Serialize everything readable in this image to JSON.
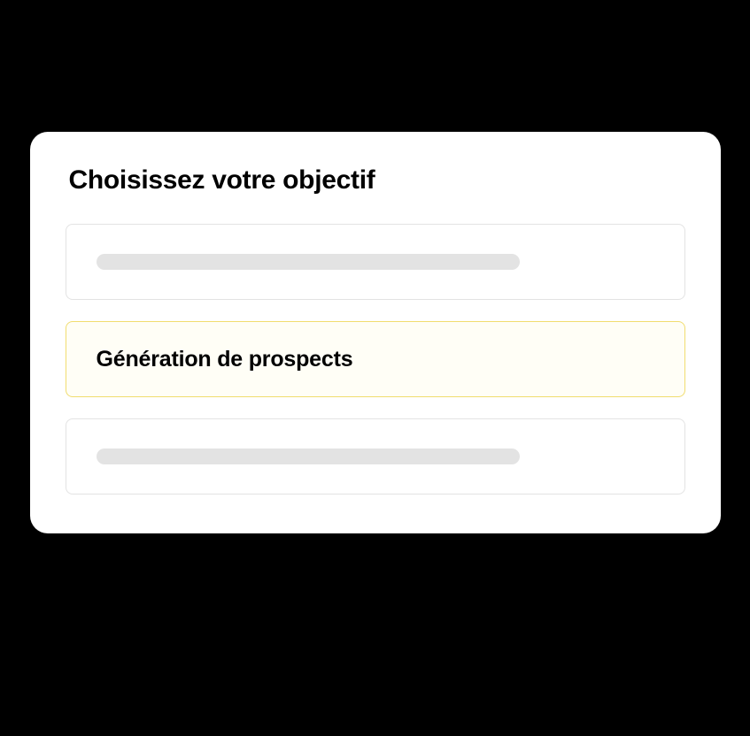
{
  "card": {
    "title": "Choisissez votre objectif",
    "options": [
      {
        "label": "",
        "placeholder": true,
        "selected": false
      },
      {
        "label": "Génération de prospects",
        "placeholder": false,
        "selected": true
      },
      {
        "label": "",
        "placeholder": true,
        "selected": false
      }
    ]
  }
}
